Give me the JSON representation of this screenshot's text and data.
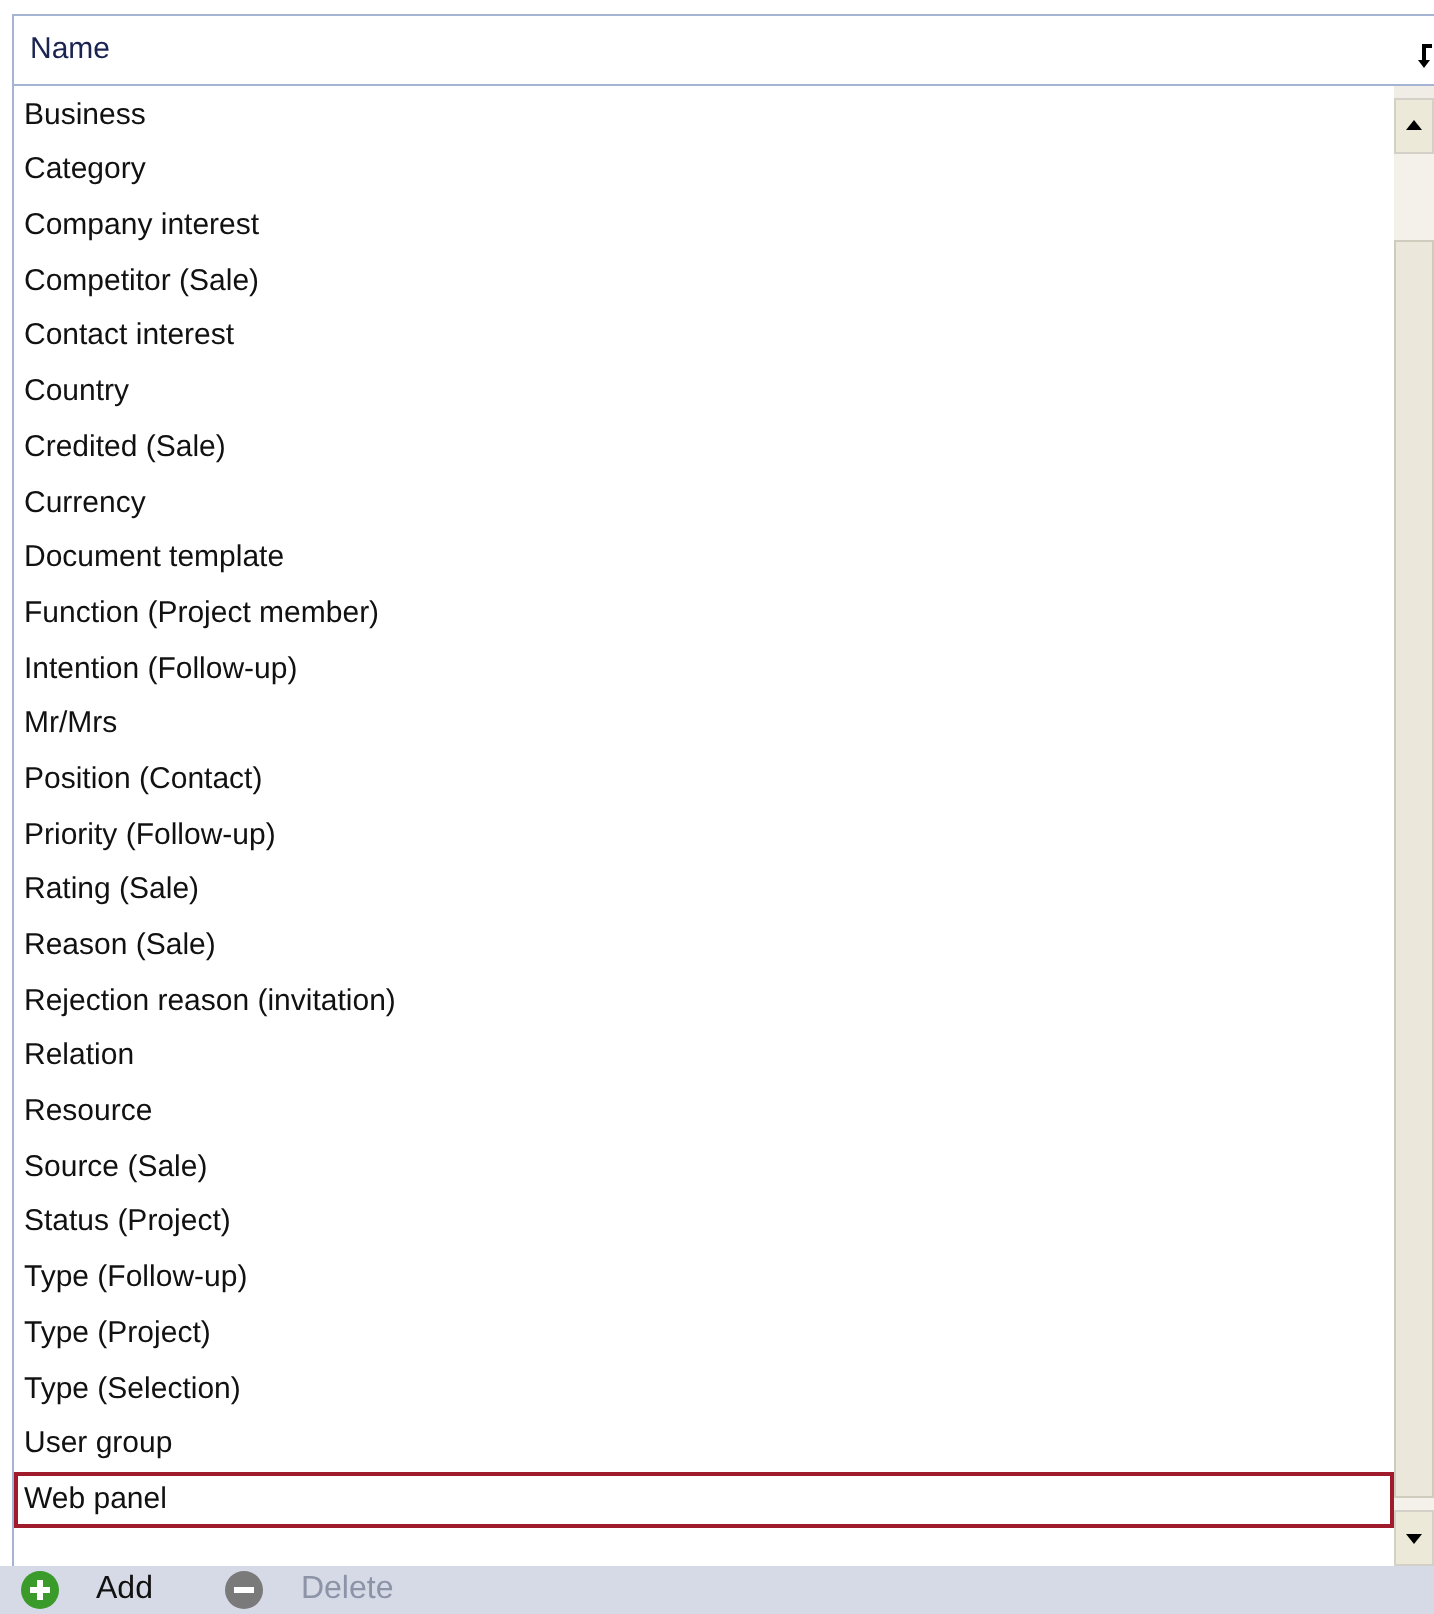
{
  "table": {
    "columns": [
      "Name"
    ],
    "rows": [
      {
        "name": "Business",
        "selected": false
      },
      {
        "name": "Category",
        "selected": false
      },
      {
        "name": "Company interest",
        "selected": false
      },
      {
        "name": "Competitor (Sale)",
        "selected": false
      },
      {
        "name": "Contact interest",
        "selected": false
      },
      {
        "name": "Country",
        "selected": false
      },
      {
        "name": "Credited (Sale)",
        "selected": false
      },
      {
        "name": "Currency",
        "selected": false
      },
      {
        "name": "Document template",
        "selected": false
      },
      {
        "name": "Function (Project member)",
        "selected": false
      },
      {
        "name": "Intention (Follow-up)",
        "selected": false
      },
      {
        "name": "Mr/Mrs",
        "selected": false
      },
      {
        "name": "Position (Contact)",
        "selected": false
      },
      {
        "name": "Priority (Follow-up)",
        "selected": false
      },
      {
        "name": "Rating (Sale)",
        "selected": false
      },
      {
        "name": "Reason (Sale)",
        "selected": false
      },
      {
        "name": "Rejection reason (invitation)",
        "selected": false
      },
      {
        "name": "Relation",
        "selected": false
      },
      {
        "name": "Resource",
        "selected": false
      },
      {
        "name": "Source (Sale)",
        "selected": false
      },
      {
        "name": "Status (Project)",
        "selected": false
      },
      {
        "name": "Type (Follow-up)",
        "selected": false
      },
      {
        "name": "Type (Project)",
        "selected": false
      },
      {
        "name": "Type (Selection)",
        "selected": false
      },
      {
        "name": "User group",
        "selected": false
      },
      {
        "name": "Web panel",
        "selected": true
      }
    ]
  },
  "toolbar": [
    {
      "label": "Add",
      "kind": "add",
      "disabled": false
    },
    {
      "label": "Delete",
      "kind": "delete",
      "disabled": true
    }
  ]
}
